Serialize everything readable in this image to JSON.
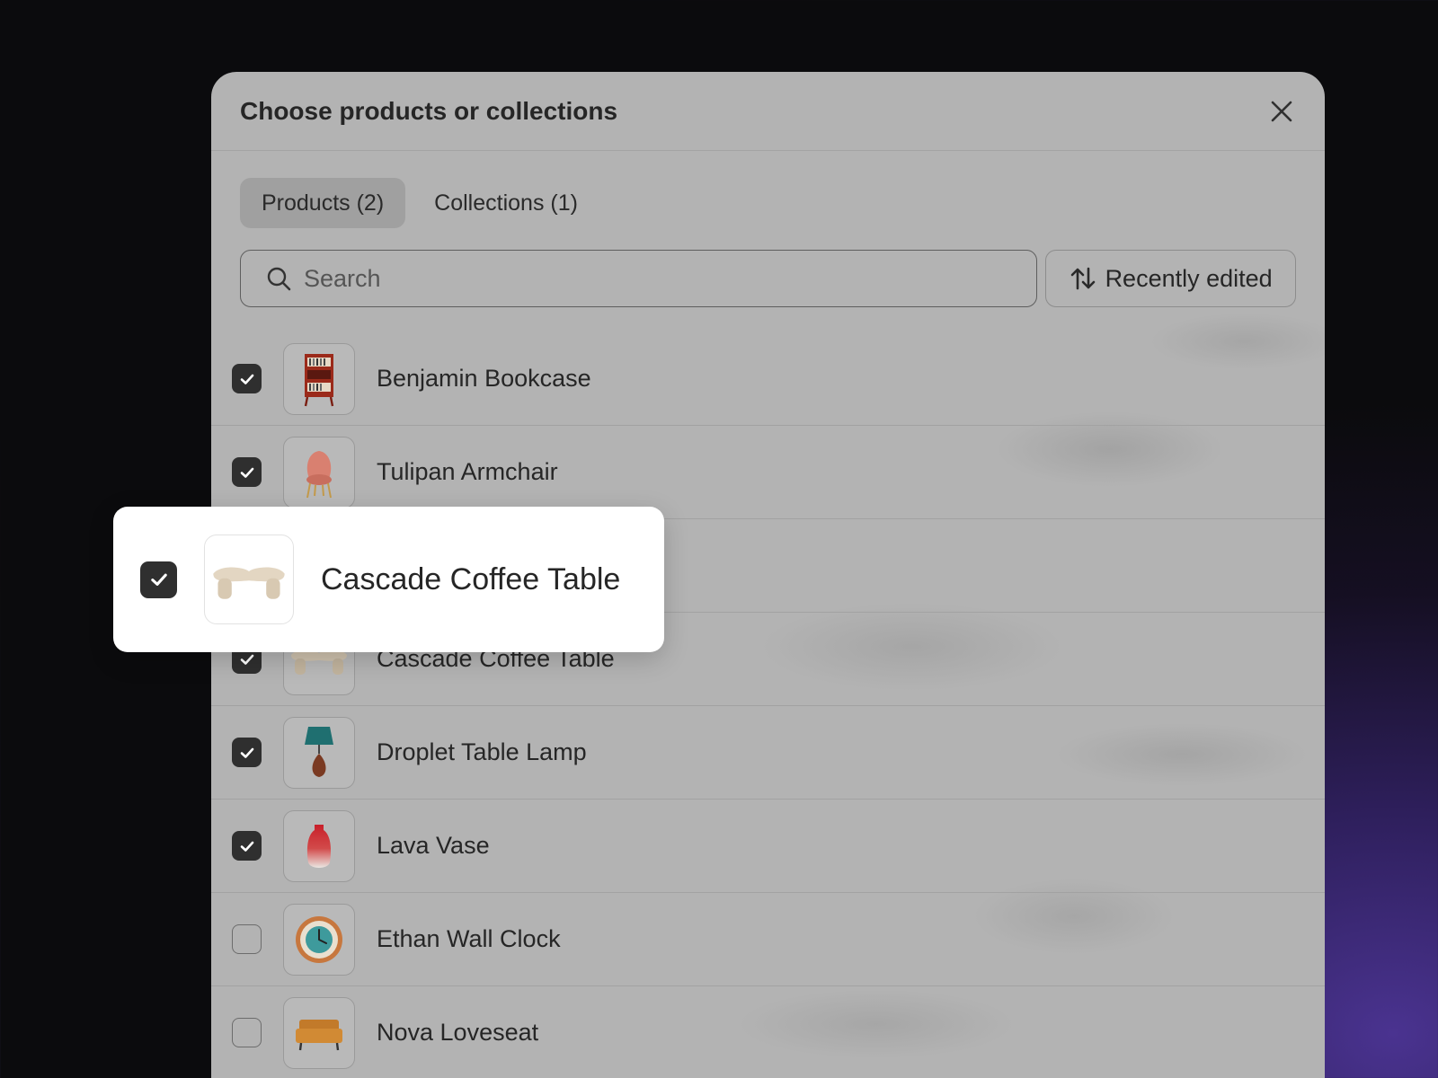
{
  "modal": {
    "title": "Choose products or collections",
    "close_icon": "close-icon"
  },
  "tabs": [
    {
      "label": "Products (2)",
      "active": true
    },
    {
      "label": "Collections (1)",
      "active": false
    }
  ],
  "search": {
    "placeholder": "Search",
    "value": "",
    "icon": "search-icon"
  },
  "sort": {
    "label": "Recently edited",
    "icon": "sort-arrows-icon"
  },
  "products": [
    {
      "name": "Benjamin Bookcase",
      "checked": true,
      "thumb_icon": "bookcase-icon"
    },
    {
      "name": "Tulipan Armchair",
      "checked": true,
      "thumb_icon": "armchair-icon"
    },
    {
      "name": "",
      "checked": true,
      "thumb_icon": ""
    },
    {
      "name": "Cascade Coffee Table",
      "checked": true,
      "thumb_icon": "coffee-table-icon"
    },
    {
      "name": "Droplet Table Lamp",
      "checked": true,
      "thumb_icon": "table-lamp-icon"
    },
    {
      "name": "Lava Vase",
      "checked": true,
      "thumb_icon": "vase-icon"
    },
    {
      "name": "Ethan Wall Clock",
      "checked": false,
      "thumb_icon": "wall-clock-icon"
    },
    {
      "name": "Nova Loveseat",
      "checked": false,
      "thumb_icon": "loveseat-icon"
    }
  ],
  "callout": {
    "name": "Cascade Coffee Table",
    "checked": true,
    "thumb_icon": "coffee-table-icon"
  },
  "colors": {
    "checkbox_checked": "#2f2f2f",
    "modal_bg": "#b3b3b3",
    "callout_bg": "#ffffff"
  }
}
